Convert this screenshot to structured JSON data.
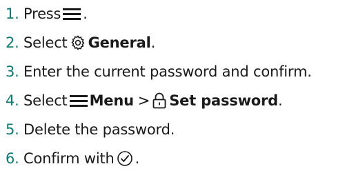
{
  "steps": [
    {
      "number": "1.",
      "text_before": "Press",
      "icon": "hamburger-menu-icon",
      "text_after": "."
    },
    {
      "number": "2.",
      "text_before": "Select",
      "icon": "gear-icon",
      "bold_label": "General",
      "text_after": "."
    },
    {
      "number": "3.",
      "text": "Enter the current password and confirm."
    },
    {
      "number": "4.",
      "text_before": "Select",
      "icon": "hamburger-menu-icon",
      "bold_label": "Menu",
      "separator": ">",
      "icon2": "lock-icon",
      "bold_label2": "Set password",
      "text_after": "."
    },
    {
      "number": "5.",
      "text": "Delete the password."
    },
    {
      "number": "6.",
      "text_before": "Confirm with",
      "icon": "checkmark-circle-icon",
      "text_after": "."
    }
  ],
  "colors": {
    "number": "#0e7a73",
    "text": "#1a1a1a"
  }
}
